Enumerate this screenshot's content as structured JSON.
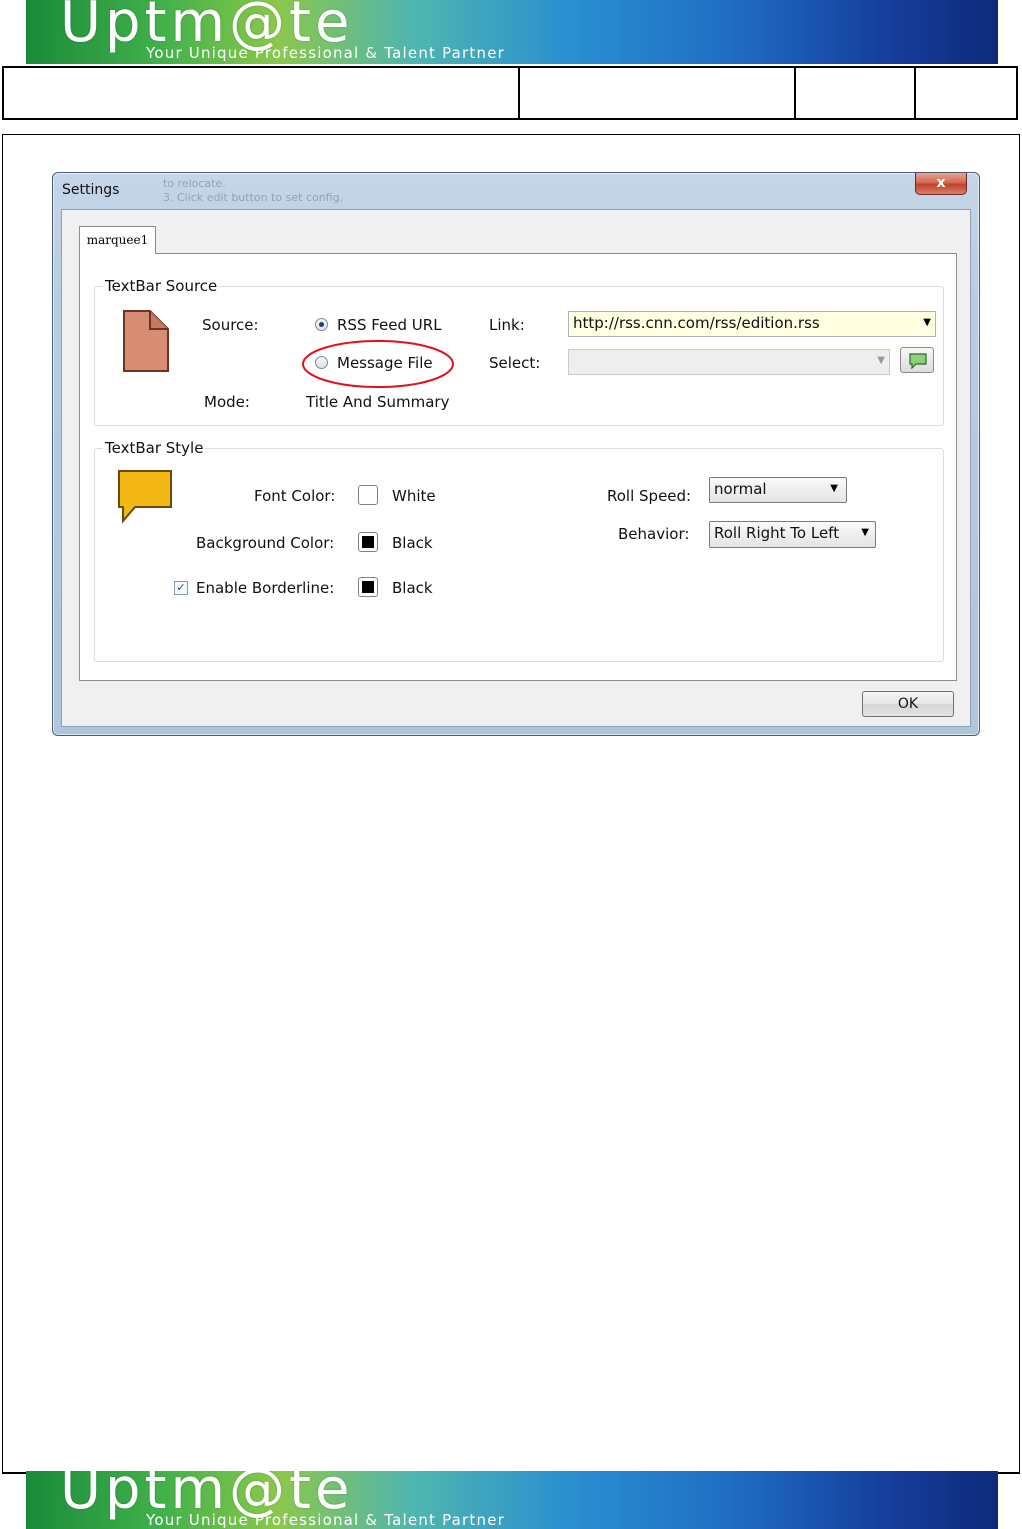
{
  "banner": {
    "logo_text": "Uptm@te",
    "tagline": "Your Unique Professional & Talent Partner"
  },
  "window": {
    "title": "Settings",
    "close_label": "x",
    "background_text_1": "to relocate.",
    "background_text_2": "3. Click edit button to set config."
  },
  "tabs": [
    {
      "label": "marquee1",
      "selected": true
    }
  ],
  "textbar_source": {
    "group_title": "TextBar Source",
    "source_label": "Source:",
    "options": [
      {
        "label": "RSS Feed URL",
        "checked": true
      },
      {
        "label": "Message File",
        "checked": false
      }
    ],
    "mode_label": "Mode:",
    "mode_value": "Title And Summary",
    "link_label": "Link:",
    "link_value": "http://rss.cnn.com/rss/edition.rss",
    "select_label": "Select:",
    "select_value": "",
    "file_icon": "document-icon",
    "message_button_icon": "speech-bubble-icon"
  },
  "textbar_style": {
    "group_title": "TextBar Style",
    "style_icon": "speech-bubble-icon",
    "font_color_label": "Font Color:",
    "font_color_value": "White",
    "font_color_hex": "#ffffff",
    "background_color_label": "Background Color:",
    "background_color_value": "Black",
    "background_color_hex": "#000000",
    "borderline_label": "Enable Borderline:",
    "borderline_enabled": true,
    "borderline_color_value": "Black",
    "borderline_color_hex": "#000000",
    "roll_speed_label": "Roll Speed:",
    "roll_speed_value": "normal",
    "behavior_label": "Behavior:",
    "behavior_value": "Roll Right To Left"
  },
  "buttons": {
    "ok_label": "OK"
  },
  "colors": {
    "annotation_red": "#e0121e",
    "link_field_bg": "#fefee0"
  }
}
